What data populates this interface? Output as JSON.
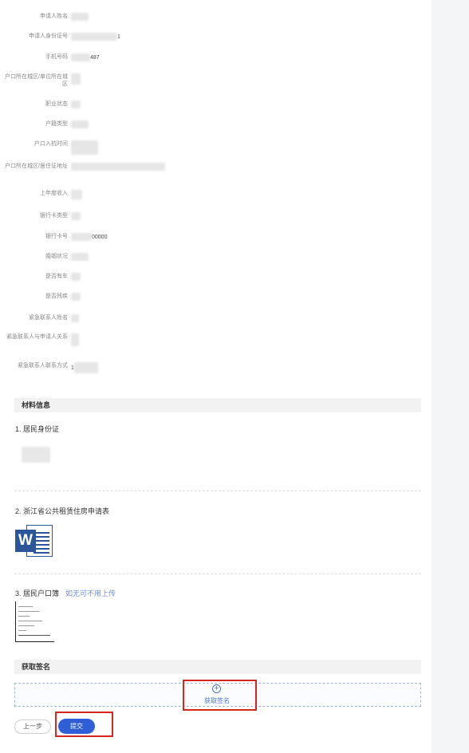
{
  "applicant_fields": [
    {
      "label": "申请人姓名",
      "value": ""
    },
    {
      "label": "申请人身份证号",
      "value": "1"
    },
    {
      "label": "手机号码",
      "value": "487"
    },
    {
      "label": "户口所在城区/单位所在城区",
      "value": ""
    },
    {
      "label": "职业状态",
      "value": ""
    },
    {
      "label": "户籍类型",
      "value": ""
    },
    {
      "label": "户口入杭时间",
      "value": ""
    },
    {
      "label": "户口所在城区/居住证地址",
      "value": ""
    },
    {
      "label": "上年度收入",
      "value": ""
    },
    {
      "label": "银行卡类型",
      "value": ""
    },
    {
      "label": "银行卡号",
      "value": "00000"
    },
    {
      "label": "婚姻状况",
      "value": ""
    },
    {
      "label": "是否有车",
      "value": ""
    },
    {
      "label": "是否残疾",
      "value": ""
    },
    {
      "label": "紧急联系人姓名",
      "value": ""
    },
    {
      "label": "紧急联系人与申请人关系",
      "value": ""
    },
    {
      "label": "紧急联系人联系方式",
      "value": "1"
    }
  ],
  "materials": {
    "section_title": "材料信息",
    "items": [
      {
        "title": "1. 居民身份证",
        "hint": ""
      },
      {
        "title": "2. 浙江省公共租赁住房申请表",
        "hint": ""
      },
      {
        "title": "3. 居民户口簿",
        "hint": "如无可不用上传"
      }
    ],
    "word_badge": "W"
  },
  "signature": {
    "section_title": "获取签名",
    "plus_glyph": "+",
    "action_label": "获取签名"
  },
  "footer": {
    "prev_label": "上一步",
    "submit_label": "提交"
  },
  "colors": {
    "accent": "#2e5fd6",
    "highlight_frame": "#d9251d"
  }
}
